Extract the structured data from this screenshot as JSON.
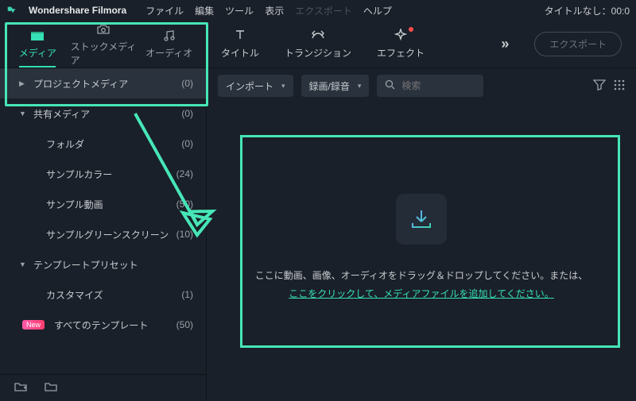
{
  "app": {
    "name": "Wondershare Filmora",
    "title": "タイトルなし：00:0"
  },
  "menus": {
    "file": "ファイル",
    "edit": "編集",
    "tool": "ツール",
    "view": "表示",
    "export": "エクスポート",
    "help": "ヘルプ"
  },
  "primary_tabs": {
    "media": "メディア",
    "stock": "ストックメディア",
    "audio": "オーディオ"
  },
  "secondary_tabs": {
    "title": "タイトル",
    "transition": "トランジション",
    "effect": "エフェクト"
  },
  "export_button": "エクスポート",
  "sidebar": {
    "project_media": {
      "label": "プロジェクトメディア",
      "count": "(0)"
    },
    "shared_media": {
      "label": "共有メディア",
      "count": "(0)"
    },
    "folder": {
      "label": "フォルダ",
      "count": "(0)"
    },
    "sample_color": {
      "label": "サンプルカラー",
      "count": "(24)"
    },
    "sample_video": {
      "label": "サンプル動画",
      "count": "(50)"
    },
    "sample_green": {
      "label": "サンプルグリーンスクリーン",
      "count": "(10)"
    },
    "template_preset": {
      "label": "テンプレートプリセット"
    },
    "customize": {
      "label": "カスタマイズ",
      "count": "(1)"
    },
    "all_templates": {
      "label": "すべてのテンプレート",
      "count": "(50)",
      "badge": "New"
    }
  },
  "main_toolbar": {
    "import": "インポート",
    "record": "録画/録音",
    "search_placeholder": "検索"
  },
  "dropzone": {
    "line1": "ここに動画、画像、オーディオをドラッグ＆ドロップしてください。または、",
    "link": "ここをクリックして、メディアファイルを追加してください。"
  }
}
